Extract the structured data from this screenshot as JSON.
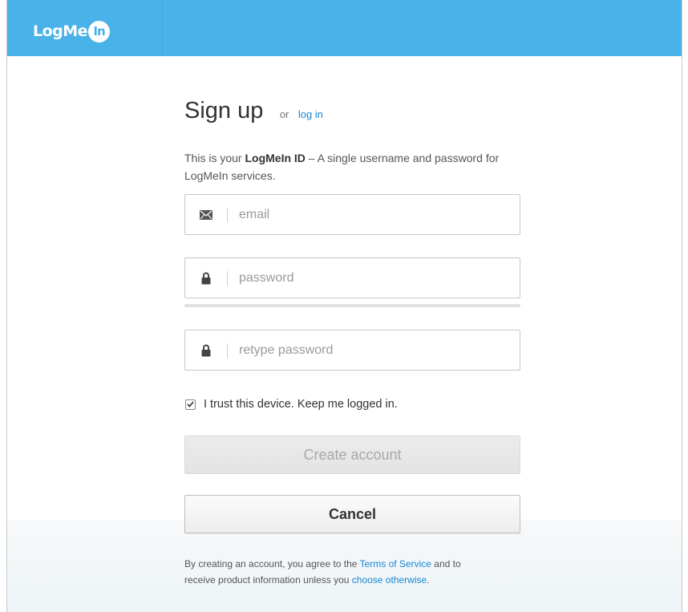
{
  "header": {
    "logo_text": "LogMe",
    "logo_badge": "In",
    "background_color": "#49b2e8"
  },
  "form": {
    "title": "Sign up",
    "or_text": "or",
    "login_link": "log in",
    "intro_prefix": "This is your ",
    "intro_bold": "LogMeIn ID",
    "intro_suffix": " – A single username and password for LogMeIn services.",
    "fields": [
      {
        "icon": "mail-icon",
        "placeholder": "email",
        "value": ""
      },
      {
        "icon": "lock-icon",
        "placeholder": "password",
        "value": ""
      },
      {
        "icon": "lock-icon",
        "placeholder": "retype password",
        "value": ""
      }
    ],
    "trust_label": "I trust this device. Keep me logged in.",
    "trust_checked": true,
    "create_button": "Create account",
    "cancel_button": "Cancel"
  },
  "legal": {
    "text1": "By creating an account, you agree to the ",
    "terms_link": "Terms of Service",
    "text2": " and to receive product information unless you ",
    "otherwise_link": "choose otherwise",
    "text3": "."
  },
  "colors": {
    "accent": "#49b2e8",
    "link": "#1a87d1",
    "disabled_button_text": "#a8a8a8"
  }
}
